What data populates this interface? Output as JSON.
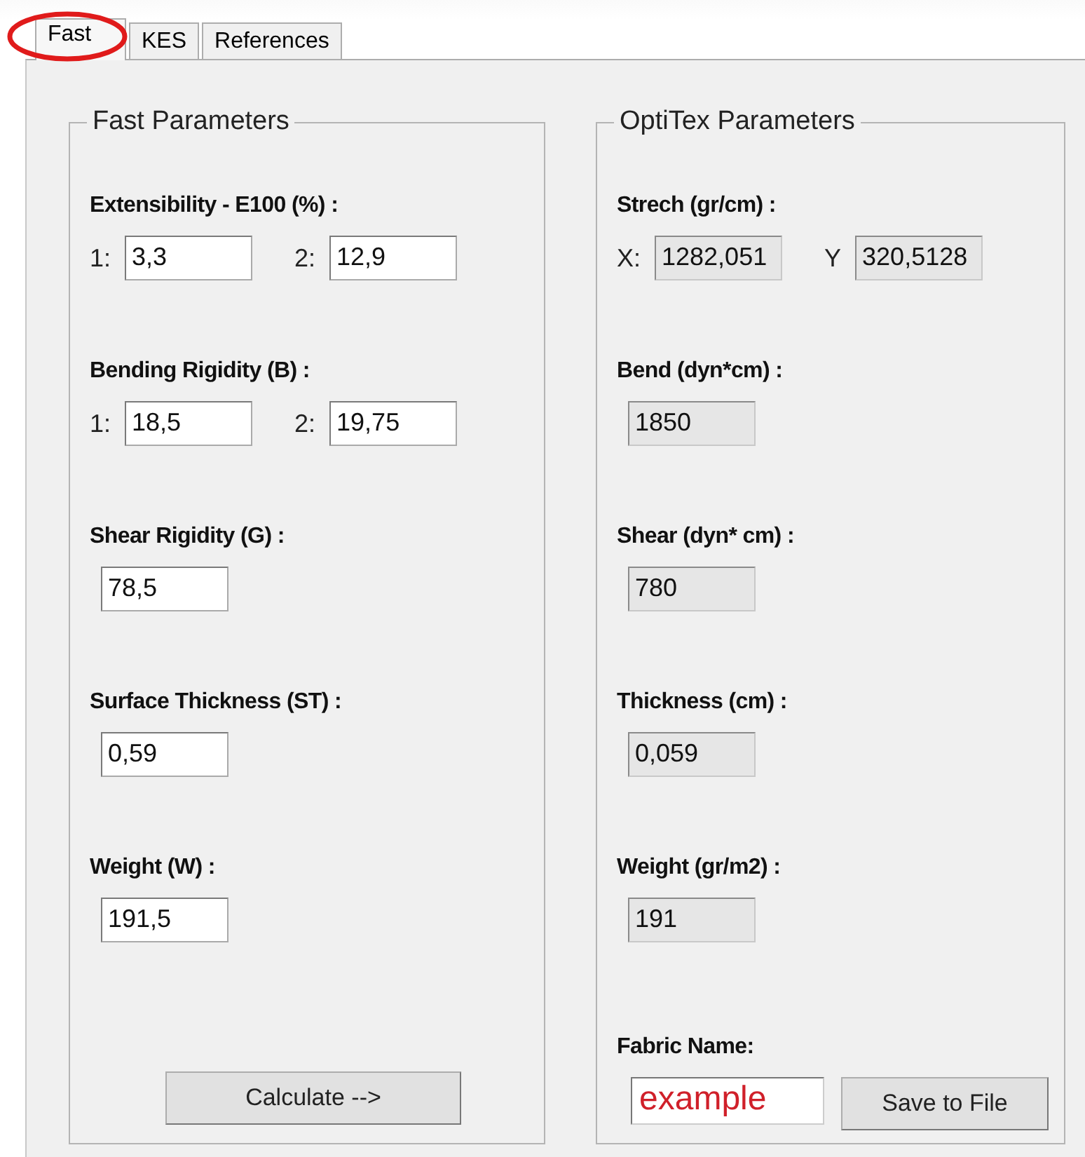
{
  "tabs": [
    {
      "label": "Fast",
      "selected": true,
      "circled": true
    },
    {
      "label": "KES",
      "selected": false,
      "circled": false
    },
    {
      "label": "References",
      "selected": false,
      "circled": false
    }
  ],
  "groups": [
    {
      "title": "Fast Parameters",
      "sections": [
        {
          "label": "Extensibility - E100 (%) :",
          "fields": [
            {
              "prefix": "1:",
              "value": "3,3",
              "readonly": false
            },
            {
              "prefix": "2:",
              "value": "12,9",
              "readonly": false
            }
          ]
        },
        {
          "label": "Bending Rigidity (B) :",
          "fields": [
            {
              "prefix": "1:",
              "value": "18,5",
              "readonly": false
            },
            {
              "prefix": "2:",
              "value": "19,75",
              "readonly": false
            }
          ]
        },
        {
          "label": "Shear Rigidity (G) :",
          "fields": [
            {
              "value": "78,5",
              "readonly": false
            }
          ]
        },
        {
          "label": "Surface Thickness (ST) :",
          "fields": [
            {
              "value": "0,59",
              "readonly": false
            }
          ]
        },
        {
          "label": "Weight (W) :",
          "fields": [
            {
              "value": "191,5",
              "readonly": false
            }
          ]
        }
      ],
      "button": "Calculate -->"
    },
    {
      "title": "OptiTex Parameters",
      "sections": [
        {
          "label": "Strech (gr/cm) :",
          "fields": [
            {
              "prefix": "X:",
              "value": "1282,051",
              "readonly": true
            },
            {
              "prefix": "Y",
              "value": "320,5128",
              "readonly": true
            }
          ]
        },
        {
          "label": "Bend (dyn*cm) :",
          "fields": [
            {
              "value": "1850",
              "readonly": true
            }
          ]
        },
        {
          "label": "Shear (dyn* cm) :",
          "fields": [
            {
              "value": "780",
              "readonly": true
            }
          ]
        },
        {
          "label": "Thickness (cm) :",
          "fields": [
            {
              "value": "0,059",
              "readonly": true
            }
          ]
        },
        {
          "label": "Weight (gr/m2) :",
          "fields": [
            {
              "value": "191",
              "readonly": true
            }
          ]
        }
      ],
      "fabric": {
        "label": "Fabric Name:",
        "value": "example",
        "button": "Save to File"
      }
    }
  ]
}
